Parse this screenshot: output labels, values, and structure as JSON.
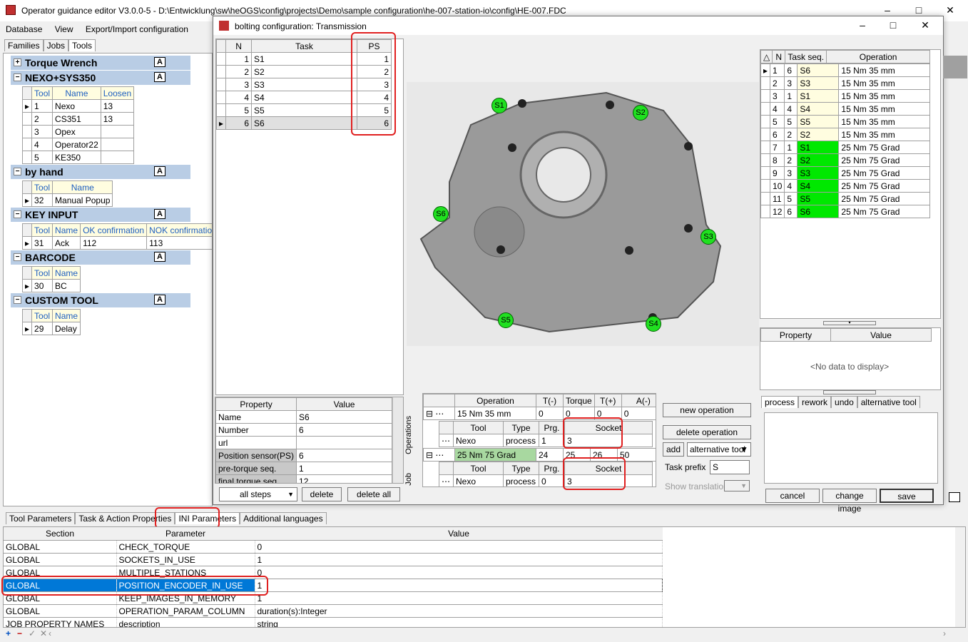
{
  "main_title": "Operator guidance editor V3.0.0-5 - D:\\Entwicklung\\sw\\heOGS\\config\\projects\\Demo\\sample configuration\\he-007-station-io\\config\\HE-007.FDC",
  "menu": [
    "Database",
    "View",
    "Export/Import configuration"
  ],
  "left_tabs": [
    "Families",
    "Jobs",
    "Tools"
  ],
  "groups": {
    "torque": "Torque Wrench",
    "nexo": "NEXO+SYS350",
    "nexo_cols": [
      "Tool",
      "Name",
      "Loosen"
    ],
    "nexo_rows": [
      [
        "1",
        "Nexo",
        "13"
      ],
      [
        "2",
        "CS351",
        "13"
      ],
      [
        "3",
        "Opex",
        ""
      ],
      [
        "4",
        "Operator22",
        ""
      ],
      [
        "5",
        "KE350",
        ""
      ]
    ],
    "byhand": "by hand",
    "byhand_cols": [
      "Tool",
      "Name"
    ],
    "byhand_rows": [
      [
        "32",
        "Manual Popup"
      ]
    ],
    "key": "KEY INPUT",
    "key_cols": [
      "Tool",
      "Name",
      "OK confirmation",
      "NOK confirmation"
    ],
    "key_rows": [
      [
        "31",
        "Ack",
        "112",
        "113"
      ]
    ],
    "barcode": "BARCODE",
    "barcode_cols": [
      "Tool",
      "Name"
    ],
    "barcode_rows": [
      [
        "30",
        "BC"
      ]
    ],
    "custom": "CUSTOM TOOL",
    "custom_cols": [
      "Tool",
      "Name"
    ],
    "custom_rows": [
      [
        "29",
        "Delay"
      ]
    ]
  },
  "dialog_title": "bolting configuration:  Transmission",
  "task_cols": [
    "N",
    "Task",
    "PS"
  ],
  "tasks": [
    [
      "1",
      "S1",
      "1"
    ],
    [
      "2",
      "S2",
      "2"
    ],
    [
      "3",
      "S3",
      "3"
    ],
    [
      "4",
      "S4",
      "4"
    ],
    [
      "5",
      "S5",
      "5"
    ],
    [
      "6",
      "S6",
      "6"
    ]
  ],
  "prop_cols": [
    "Property",
    "Value"
  ],
  "props": [
    [
      "Name",
      "S6"
    ],
    [
      "Number",
      "6"
    ],
    [
      "url",
      ""
    ],
    [
      "Position sensor(PS)",
      "6"
    ],
    [
      "pre-torque seq.",
      "1"
    ],
    [
      "final torque seq.",
      "12"
    ]
  ],
  "steps_select": "all steps",
  "delete": "delete",
  "delete_all": "delete all",
  "markers": [
    "S1",
    "S2",
    "S3",
    "S4",
    "S5",
    "S6"
  ],
  "side_tabs": [
    "Operations",
    "Job"
  ],
  "op_cols": [
    "Operation",
    "T(-)",
    "Torque",
    "T(+)",
    "A(-)"
  ],
  "op1": [
    "15 Nm 35 mm",
    "0",
    "0",
    "0",
    "0"
  ],
  "op2": [
    "25 Nm 75 Grad",
    "24",
    "25",
    "26",
    "50"
  ],
  "sub_cols": [
    "Tool",
    "Type",
    "Prg.",
    "Socket"
  ],
  "sub1": [
    "Nexo",
    "process",
    "1",
    "3"
  ],
  "sub2": [
    "Nexo",
    "process",
    "0",
    "3"
  ],
  "new_op": "new operation",
  "del_op": "delete operation",
  "add": "add",
  "alt_tool_select": "alternative tool",
  "task_prefix_label": "Task prefix",
  "task_prefix": "S",
  "show_translation": "Show translation",
  "seq_cols": [
    "N",
    "Task seq.",
    "Operation"
  ],
  "seq_rows": [
    [
      "1",
      "6",
      "S6",
      "15 Nm 35 mm",
      "y"
    ],
    [
      "2",
      "3",
      "S3",
      "15 Nm 35 mm",
      "y"
    ],
    [
      "3",
      "1",
      "S1",
      "15 Nm 35 mm",
      "y"
    ],
    [
      "4",
      "4",
      "S4",
      "15 Nm 35 mm",
      "y"
    ],
    [
      "5",
      "5",
      "S5",
      "15 Nm 35 mm",
      "y"
    ],
    [
      "6",
      "2",
      "S2",
      "15 Nm 35 mm",
      "y"
    ],
    [
      "7",
      "1",
      "S1",
      "25 Nm 75 Grad",
      "g"
    ],
    [
      "8",
      "2",
      "S2",
      "25 Nm 75 Grad",
      "g"
    ],
    [
      "9",
      "3",
      "S3",
      "25 Nm 75 Grad",
      "g"
    ],
    [
      "10",
      "4",
      "S4",
      "25 Nm 75 Grad",
      "g"
    ],
    [
      "11",
      "5",
      "S5",
      "25 Nm 75 Grad",
      "g"
    ],
    [
      "12",
      "6",
      "S6",
      "25 Nm 75 Grad",
      "g"
    ]
  ],
  "right_prop_cols": [
    "Property",
    "Value"
  ],
  "no_data": "<No data to display>",
  "right_tabs": [
    "process",
    "rework",
    "undo",
    "alternative tool"
  ],
  "cancel": "cancel",
  "change_image": "change image",
  "save": "save",
  "bottom_tabs": [
    "Tool Parameters",
    "Task & Action Properties",
    "INI Parameters",
    "Additional languages"
  ],
  "ini_cols": [
    "Section",
    "Parameter",
    "Value"
  ],
  "ini_rows": [
    [
      "GLOBAL",
      "CHECK_TORQUE",
      "0"
    ],
    [
      "GLOBAL",
      "SOCKETS_IN_USE",
      "1"
    ],
    [
      "GLOBAL",
      "MULTIPLE_STATIONS",
      "0"
    ],
    [
      "GLOBAL",
      "POSITION_ENCODER_IN_USE",
      "1"
    ],
    [
      "GLOBAL",
      "KEEP_IMAGES_IN_MEMORY",
      "1"
    ],
    [
      "GLOBAL",
      "OPERATION_PARAM_COLUMN",
      "duration(s):Integer"
    ],
    [
      "JOB PROPERTY NAMES",
      "description",
      "string"
    ]
  ]
}
